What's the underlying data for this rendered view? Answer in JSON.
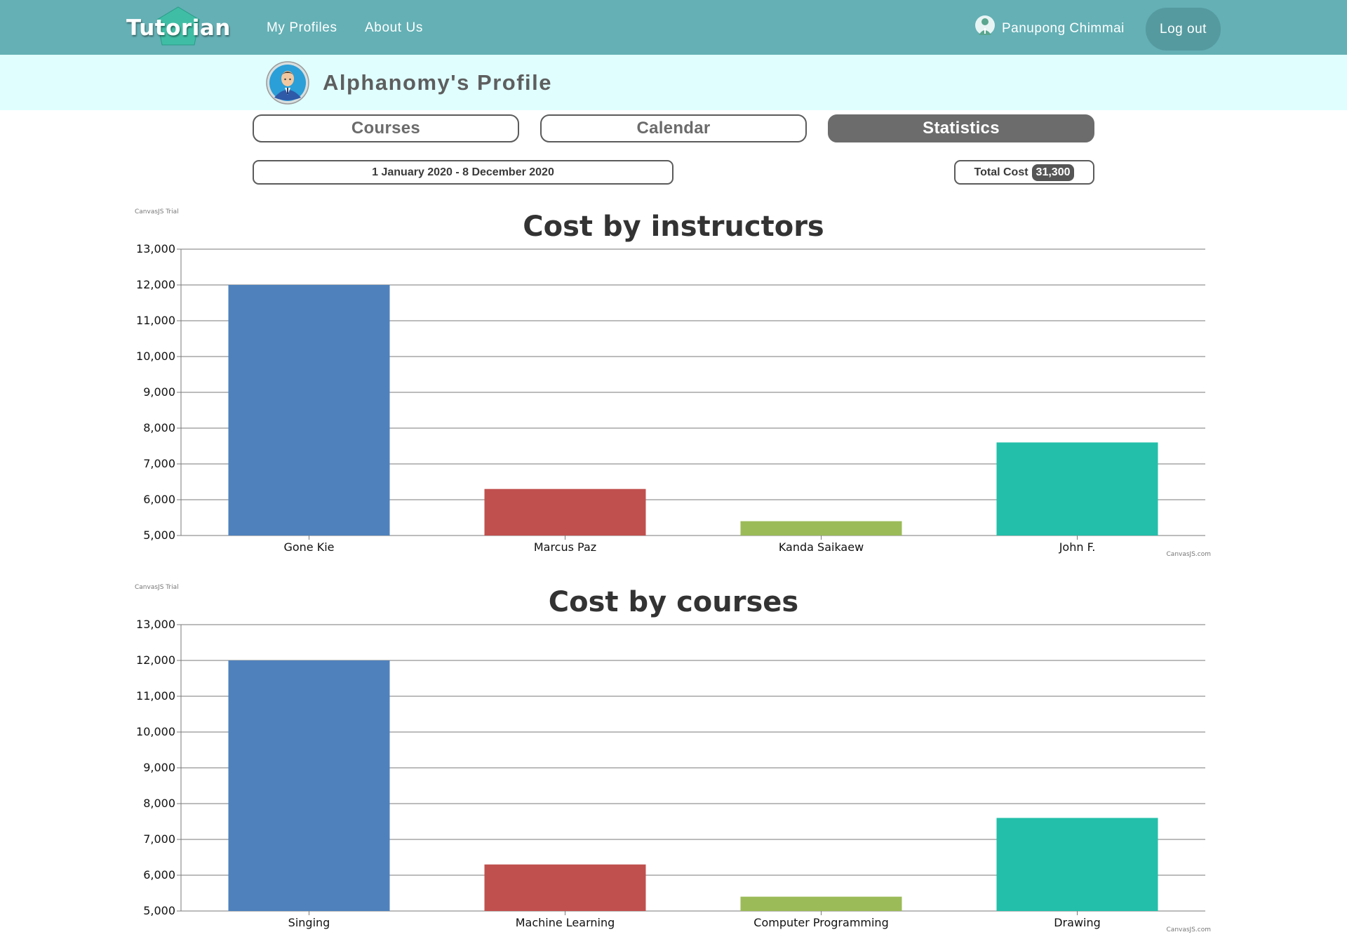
{
  "nav": {
    "logo": "Tutorian",
    "my_profiles": "My Profiles",
    "about_us": "About Us",
    "user_name": "Panupong Chimmai",
    "logout": "Log out"
  },
  "profile": {
    "title": "Alphanomy's Profile"
  },
  "tabs": [
    {
      "label": "Courses",
      "active": false
    },
    {
      "label": "Calendar",
      "active": false
    },
    {
      "label": "Statistics",
      "active": true
    }
  ],
  "filters": {
    "date_range": "1 January 2020 - 8 December 2020",
    "total_cost_label": "Total Cost",
    "total_cost_value": "31,300"
  },
  "colors": {
    "topbar": "#64b0b5",
    "profile_band": "#e0fefe",
    "active_tab": "#6c6c6c",
    "series": [
      "#4f81bc",
      "#c0504e",
      "#9bbb58",
      "#23bfaa"
    ]
  },
  "chart_data": [
    {
      "type": "bar",
      "title": "Cost by instructors",
      "watermark_top": "CanvasJS Trial",
      "watermark_bottom": "CanvasJS.com",
      "categories": [
        "Gone Kie",
        "Marcus Paz",
        "Kanda Saikaew",
        "John F."
      ],
      "values": [
        12000,
        6300,
        5400,
        7600
      ],
      "ylim": [
        5000,
        13000
      ],
      "ytick_step": 1000,
      "grid": true,
      "xlabel": "",
      "ylabel": ""
    },
    {
      "type": "bar",
      "title": "Cost by courses",
      "watermark_top": "CanvasJS Trial",
      "watermark_bottom": "CanvasJS.com",
      "categories": [
        "Singing",
        "Machine Learning",
        "Computer Programming",
        "Drawing"
      ],
      "values": [
        12000,
        6300,
        5400,
        7600
      ],
      "ylim": [
        5000,
        13000
      ],
      "ytick_step": 1000,
      "grid": true,
      "xlabel": "",
      "ylabel": ""
    }
  ]
}
